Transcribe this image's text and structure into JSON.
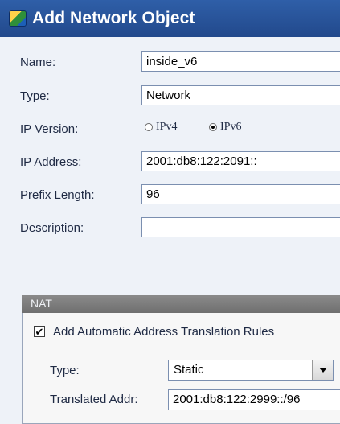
{
  "window": {
    "title": "Add Network Object",
    "icon": "network-object-icon"
  },
  "form": {
    "name": {
      "label": "Name:",
      "value": "inside_v6"
    },
    "type": {
      "label": "Type:",
      "value": "Network"
    },
    "ip_version": {
      "label": "IP Version:",
      "options": [
        "IPv4",
        "IPv6"
      ],
      "selected": "IPv6"
    },
    "ip_address": {
      "label": "IP Address:",
      "value": "2001:db8:122:2091::"
    },
    "prefix_length": {
      "label": "Prefix Length:",
      "value": "96"
    },
    "description": {
      "label": "Description:",
      "value": ""
    }
  },
  "nat": {
    "title": "NAT",
    "auto_rules": {
      "label": "Add Automatic Address Translation Rules",
      "checked": true
    },
    "type": {
      "label": "Type:",
      "value": "Static"
    },
    "translated_addr": {
      "label": "Translated Addr:",
      "value": "2001:db8:122:2999::/96"
    }
  },
  "colors": {
    "titlebar": "#2f5fa8",
    "background": "#eef2f8",
    "nat_header": "#7d7d7d"
  }
}
